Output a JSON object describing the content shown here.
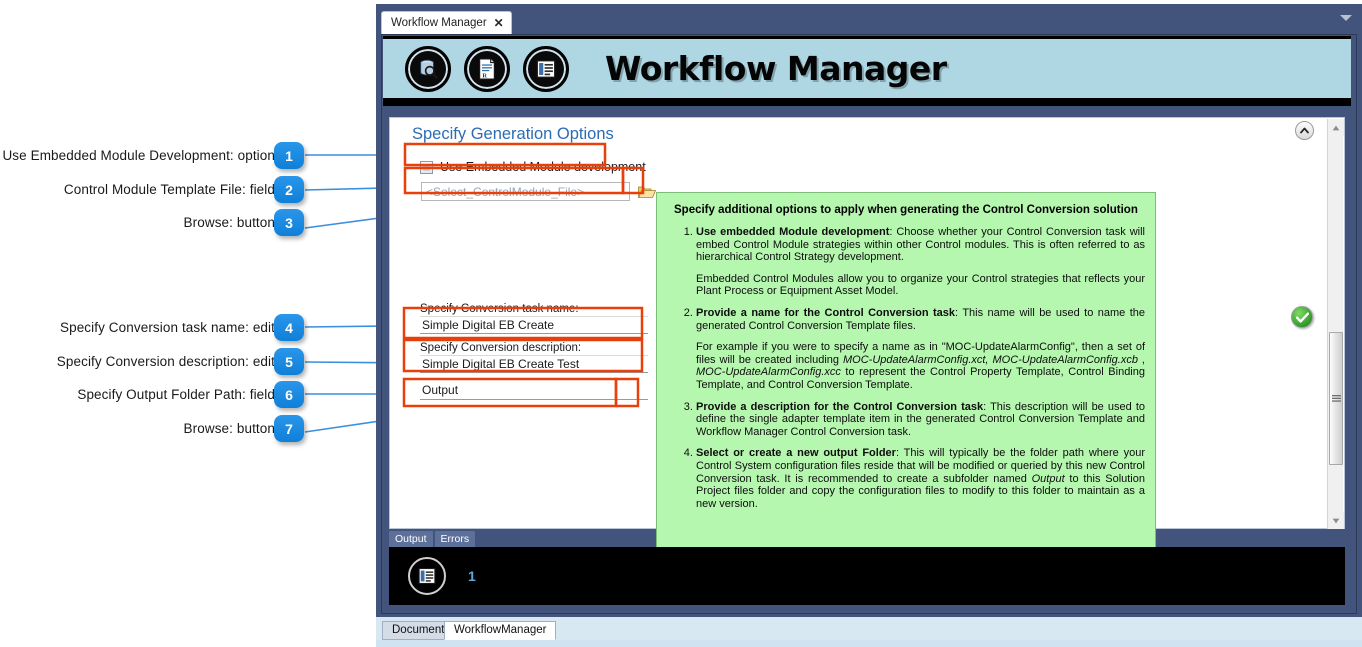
{
  "window": {
    "tab_label": "Workflow Manager",
    "close_icon": "close-icon",
    "dropdown_icon": "chevron-down-icon"
  },
  "banner": {
    "title": "Workflow Manager",
    "icons": [
      "search-database-icon",
      "report-document-icon",
      "list-document-icon"
    ]
  },
  "panel": {
    "section_title": "Specify Generation Options",
    "collapse_icon": "chevron-up-icon",
    "checkbox": {
      "label": "Use Embedded Module development",
      "checked": false
    },
    "control_module_file": {
      "placeholder": "<Select_ControlModule_File>",
      "value": "",
      "browse_icon": "folder-open-icon"
    },
    "task_name": {
      "label": "Specify Conversion task name:",
      "value": "Simple Digital EB Create"
    },
    "task_description": {
      "label": "Specify Conversion description:",
      "value": "Simple Digital EB Create Test"
    },
    "output_folder": {
      "value": "Output",
      "browse_icon": "folder-open-icon"
    },
    "status_icon": "green-check-icon",
    "scrollbar": {
      "up_icon": "scroll-up-arrow-icon",
      "down_icon": "scroll-down-arrow-icon"
    }
  },
  "help": {
    "heading": "Specify additional options to apply when generating the Control Conversion solution",
    "items": [
      {
        "bold": "Use embedded Module development",
        "rest": ": Choose whether your Control Conversion task will embed Control Module strategies within other Control modules. This is often referred to as hierarchical Control Strategy development.",
        "extra_plain": "Embedded Control Modules allow you to organize your Control strategies that reflects your Plant Process or Equipment Asset Model."
      },
      {
        "bold": "Provide a name for the Control Conversion task",
        "rest": ": This name will be used to name the generated Control Conversion Template files.",
        "extra_prefix": "For example if you were to specify a name as in \"MOC-UpdateAlarmConfig\", then a set of files will be created including ",
        "extra_italic_1": "MOC-UpdateAlarmConfig.xct,",
        "extra_italic_2": "MOC-UpdateAlarmConfig.xcb",
        "extra_mid": " , ",
        "extra_italic_3": "MOC-UpdateAlarmConfig.xcc",
        "extra_suffix": " to represent the Control Property Template, Control Binding Template, and Control Conversion Template."
      },
      {
        "bold": "Provide a description for the Control Conversion task",
        "rest": ": This description will be used to define the single adapter template item in the generated Control Conversion Template and Workflow Manager Control Conversion task."
      },
      {
        "bold": "Select or create a new output Folder",
        "rest_a": ": This will typically be the folder path where your Control System configuration files reside that will be modified or queried by this new Control Conversion task. It is recommended to create a subfolder named ",
        "italic": "Output",
        "rest_b": " to this Solution Project files folder and copy the configuration files to modify to this folder to maintain as a new version."
      }
    ]
  },
  "dock": {
    "tabs": [
      "Output",
      "Errors"
    ],
    "icon": "list-document-icon",
    "count": "1"
  },
  "status_tabs": [
    {
      "label": "Documents",
      "active": false
    },
    {
      "label": "WorkflowManager",
      "active": true
    }
  ],
  "annotations": [
    {
      "num": "1",
      "label": "Use Embedded Module Development: option"
    },
    {
      "num": "2",
      "label": "Control Module Template File: field"
    },
    {
      "num": "3",
      "label": "Browse: button"
    },
    {
      "num": "4",
      "label": "Specify Conversion task name: edit"
    },
    {
      "num": "5",
      "label": "Specify Conversion description: edit"
    },
    {
      "num": "6",
      "label": "Specify Output Folder Path: field"
    },
    {
      "num": "7",
      "label": "Browse: button"
    }
  ],
  "colors": {
    "frame": "#42547c",
    "banner": "#aed7e3",
    "help_bg": "#b6f7b0",
    "accent": "#1b8ae5",
    "highlight_box": "#e8400c",
    "section_title": "#2b6cb5"
  }
}
